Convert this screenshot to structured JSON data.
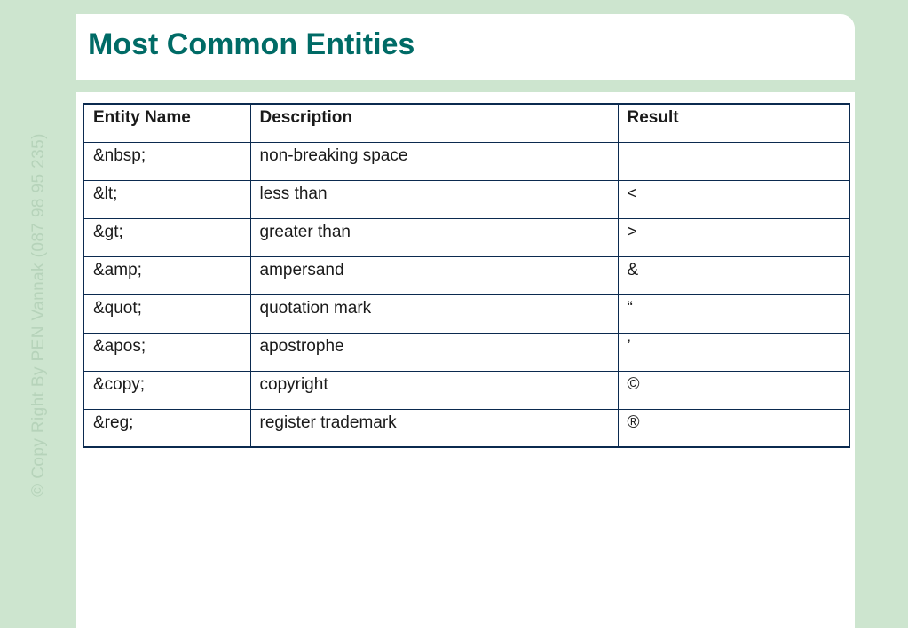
{
  "slide": {
    "title": "Most Common Entities",
    "watermark": "© Copy Right By PEN Vannak (087 98 95 235)"
  },
  "table": {
    "headers": [
      "Entity Name",
      "Description",
      "Result"
    ],
    "rows": [
      [
        "&nbsp;",
        "non-breaking space",
        ""
      ],
      [
        "&lt;",
        "less than",
        "<"
      ],
      [
        "&gt;",
        "greater than",
        ">"
      ],
      [
        "&amp;",
        "ampersand",
        "&"
      ],
      [
        "&quot;",
        "quotation mark",
        "“"
      ],
      [
        "&apos;",
        "apostrophe",
        "’"
      ],
      [
        "&copy;",
        "copyright",
        "©"
      ],
      [
        "&reg;",
        "register trademark",
        "®"
      ]
    ]
  },
  "colors": {
    "background": "#cde5cf",
    "title": "#006b66",
    "table_border": "#0b2a4f",
    "watermark": "#b6d3ba"
  }
}
